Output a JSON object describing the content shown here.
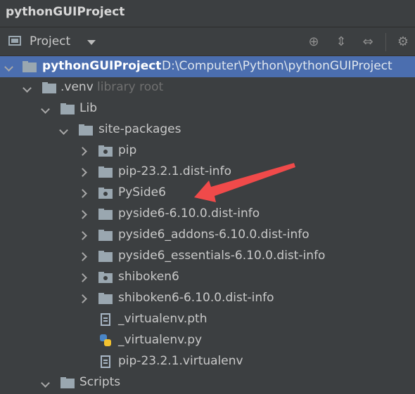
{
  "window": {
    "title": "pythonGUIProject"
  },
  "toolbar": {
    "view_label": "Project",
    "buttons": [
      "locate-icon",
      "expand-all-icon",
      "collapse-all-icon",
      "settings-icon"
    ]
  },
  "tree": {
    "root": {
      "label": "pythonGUIProject",
      "path": "D:\\Computer\\Python\\pythonGUIProject"
    },
    "venv": {
      "label": ".venv",
      "hint": "library root"
    },
    "lib": {
      "label": "Lib"
    },
    "site_packages": {
      "label": "site-packages"
    },
    "items": [
      {
        "label": "pip",
        "kind": "package"
      },
      {
        "label": "pip-23.2.1.dist-info",
        "kind": "folder"
      },
      {
        "label": "PySide6",
        "kind": "package"
      },
      {
        "label": "pyside6-6.10.0.dist-info",
        "kind": "folder"
      },
      {
        "label": "pyside6_addons-6.10.0.dist-info",
        "kind": "folder"
      },
      {
        "label": "pyside6_essentials-6.10.0.dist-info",
        "kind": "folder"
      },
      {
        "label": "shiboken6",
        "kind": "package"
      },
      {
        "label": "shiboken6-6.10.0.dist-info",
        "kind": "folder"
      }
    ],
    "files": [
      {
        "label": "_virtualenv.pth",
        "kind": "text-file"
      },
      {
        "label": "_virtualenv.py",
        "kind": "python-file"
      },
      {
        "label": "pip-23.2.1.virtualenv",
        "kind": "text-file"
      }
    ],
    "scripts": {
      "label": "Scripts"
    }
  },
  "colors": {
    "selection": "#4b6eaf",
    "background": "#3c3f41",
    "annotation_arrow": "#f04a4a"
  }
}
